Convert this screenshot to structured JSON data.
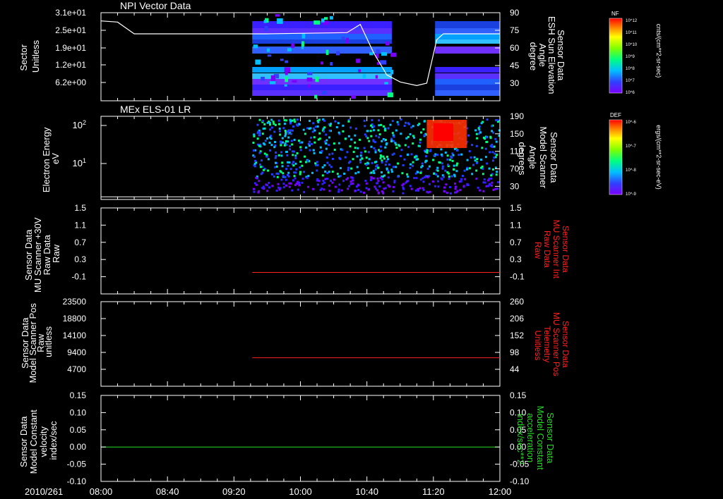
{
  "chart_data": [
    {
      "type": "heatmap",
      "title": "NPI Vector Data",
      "ylabel": [
        "Sector",
        "Unitless"
      ],
      "y_ticks": [
        "3.1e+01",
        "2.5e+01",
        "1.9e+01",
        "1.2e+01",
        "6.2e+00"
      ],
      "y2label": [
        "Sensor Data",
        "ESH Sun Elevation",
        "Angle",
        "degree"
      ],
      "y2_ticks": [
        "90",
        "75",
        "60",
        "45",
        "30"
      ],
      "y2lim": [
        15,
        90
      ],
      "line_series": {
        "name": "Sensor Data ESH Sun Elevation Angle",
        "color": "#ffffff",
        "points": [
          [
            "08:00",
            83
          ],
          [
            "08:10",
            82
          ],
          [
            "08:20",
            72
          ],
          [
            "09:40",
            72
          ],
          [
            "10:28",
            73
          ],
          [
            "10:36",
            80
          ],
          [
            "10:44",
            56
          ],
          [
            "10:52",
            37
          ],
          [
            "11:00",
            31
          ],
          [
            "11:10",
            28
          ],
          [
            "11:16",
            30
          ],
          [
            "11:22",
            67
          ],
          [
            "11:26",
            72
          ],
          [
            "12:00",
            72
          ]
        ]
      },
      "colorbar": {
        "label": "cnts/(cm**2-sr-sec)",
        "tag": "NF",
        "ticks": [
          "10^12",
          "10^11",
          "10^10",
          "10^9",
          "10^8",
          "10^7",
          "10^6"
        ]
      }
    },
    {
      "type": "heatmap",
      "title": "MEx ELS-01 LR",
      "ylabel": [
        "Electron Energy",
        "eV"
      ],
      "y_ticks": [
        "10^2",
        "10^1"
      ],
      "y2label": [
        "Sensor Data",
        "Model Scanner",
        "Angle",
        "degrees"
      ],
      "y2_ticks": [
        "190",
        "150",
        "110",
        "70",
        "30"
      ],
      "y2lim": [
        0,
        190
      ],
      "line_series": {
        "name": "Sensor Data Model Scanner Angle",
        "color": "#ffffff",
        "points": [
          [
            "08:00",
            6
          ],
          [
            "12:00",
            6
          ]
        ]
      },
      "colorbar": {
        "label": "ergs/(cm**2-sr-sec-eV)",
        "tag": "DEF",
        "ticks": [
          "10^-6",
          "10^-7",
          "10^-8",
          "10^-9"
        ]
      }
    },
    {
      "type": "line",
      "ylabel": [
        "Sensor Data",
        "MU Scanner +30V",
        "Raw Data",
        "Raw"
      ],
      "y_ticks": [
        "1.5",
        "1.1",
        "0.7",
        "0.3",
        "-0.1"
      ],
      "ylim": [
        -0.5,
        1.5
      ],
      "y2label": [
        "Sensor Data",
        "MU Scanner Int",
        "Raw Data",
        "Raw"
      ],
      "y2_ticks": [
        "1.5",
        "1.1",
        "0.7",
        "0.3",
        "-0.1"
      ],
      "series": [
        {
          "name": "Sensor Data MU Scanner Int Raw Data",
          "color": "#ff2020",
          "points": [
            [
              "09:31",
              0
            ],
            [
              "12:00",
              0
            ]
          ]
        }
      ]
    },
    {
      "type": "line",
      "ylabel": [
        "Sensor Data",
        "Model Scanner Pos",
        "Raw",
        "unitless"
      ],
      "y_ticks": [
        "23500",
        "18800",
        "14100",
        "9400",
        "4700"
      ],
      "ylim": [
        0,
        23500
      ],
      "y2label": [
        "Sensor Data",
        "MU Scanner Pos",
        "Telemetry",
        "Unitless"
      ],
      "y2_ticks": [
        "260",
        "206",
        "152",
        "98",
        "44"
      ],
      "series": [
        {
          "name": "Sensor Data MU Scanner Pos Telemetry",
          "color": "#ff2020",
          "points": [
            [
              "09:31",
              7900
            ],
            [
              "12:00",
              7900
            ]
          ]
        }
      ]
    },
    {
      "type": "line",
      "ylabel": [
        "Sensor Data",
        "Model Constant",
        "velocity",
        "index/sec"
      ],
      "y_ticks": [
        "0.15",
        "0.10",
        "0.05",
        "0.00",
        "-0.05",
        "-0.10"
      ],
      "ylim": [
        -0.1,
        0.15
      ],
      "y2label": [
        "Sensor Data",
        "Model Constant",
        "acceleration",
        "index/sec**2"
      ],
      "y2_ticks": [
        "0.15",
        "0.10",
        "0.05",
        "0.00",
        "-0.05",
        "-0.10"
      ],
      "series": [
        {
          "name": "Sensor Data Model Constant acceleration",
          "color": "#22dd22",
          "points": [
            [
              "08:00",
              0
            ],
            [
              "12:00",
              0
            ]
          ]
        }
      ]
    }
  ],
  "x_axis": {
    "date_label": "2010/261",
    "tick_labels": [
      "08:00",
      "08:40",
      "09:20",
      "10:00",
      "10:40",
      "11:20",
      "12:00"
    ],
    "range": [
      "08:00",
      "12:00"
    ]
  },
  "colors": {
    "background": "#000000",
    "foreground": "#ffffff",
    "red_axis": "#ff2020",
    "green_axis": "#22dd22"
  }
}
